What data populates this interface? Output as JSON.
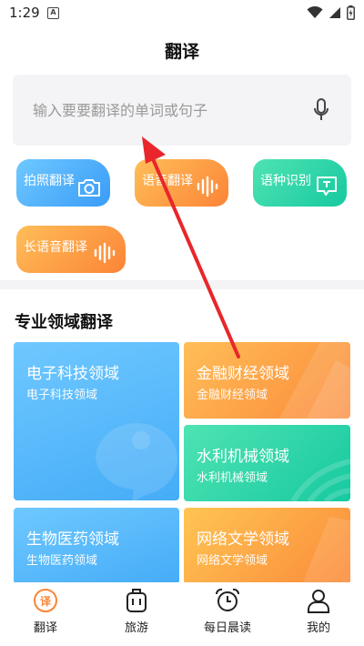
{
  "status": {
    "time": "1:29",
    "notification": "A"
  },
  "header": {
    "title": "翻译"
  },
  "search": {
    "placeholder": "输入要要翻译的单词或句子"
  },
  "quick_actions": [
    {
      "label": "拍照翻译",
      "icon": "camera-icon"
    },
    {
      "label": "语音翻译",
      "icon": "soundwave-icon"
    },
    {
      "label": "语种识别",
      "icon": "text-bubble-icon"
    },
    {
      "label": "长语音翻译",
      "icon": "soundwave-icon"
    }
  ],
  "domains": {
    "title": "专业领域翻译",
    "items": [
      {
        "title": "电子科技领域",
        "subtitle": "电子科技领域"
      },
      {
        "title": "金融财经领域",
        "subtitle": "金融财经领域"
      },
      {
        "title": "水利机械领域",
        "subtitle": "水利机械领域"
      },
      {
        "title": "生物医药领域",
        "subtitle": "生物医药领域"
      },
      {
        "title": "网络文学领域",
        "subtitle": "网络文学领域"
      }
    ]
  },
  "nav": [
    {
      "label": "翻译",
      "icon": "translate-icon",
      "active": true
    },
    {
      "label": "旅游",
      "icon": "luggage-icon",
      "active": false
    },
    {
      "label": "每日晨读",
      "icon": "alarm-clock-icon",
      "active": false
    },
    {
      "label": "我的",
      "icon": "user-icon",
      "active": false
    }
  ],
  "colors": {
    "accent_orange": "#fb8437",
    "accent_blue": "#45acf7",
    "accent_green": "#17c9a0",
    "annotation_arrow": "#e8262b"
  }
}
